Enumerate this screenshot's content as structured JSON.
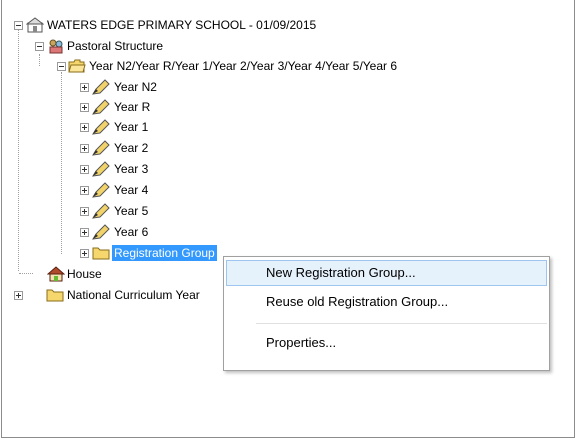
{
  "tree": {
    "root_label": "WATERS EDGE PRIMARY SCHOOL - 01/09/2015",
    "pastoral_label": "Pastoral Structure",
    "years_folder_label": "Year N2/Year R/Year 1/Year 2/Year 3/Year 4/Year 5/Year 6",
    "years": [
      "Year N2",
      "Year R",
      "Year 1",
      "Year 2",
      "Year 3",
      "Year 4",
      "Year 5",
      "Year 6"
    ],
    "registration_label": "Registration Group",
    "house_label": "House",
    "national_label": "National Curriculum Year"
  },
  "context_menu": {
    "items": [
      "New Registration Group...",
      "Reuse old Registration Group...",
      "Properties..."
    ]
  },
  "icons": {
    "root": "school-icon",
    "pastoral": "pastoral-icon",
    "folder": "folder-icon",
    "year": "pencil-icon",
    "house": "house-icon"
  },
  "colors": {
    "selection": "#3399ff",
    "menu_hover": "#e5f1fb",
    "folder_yellow": "#f5d76e"
  }
}
